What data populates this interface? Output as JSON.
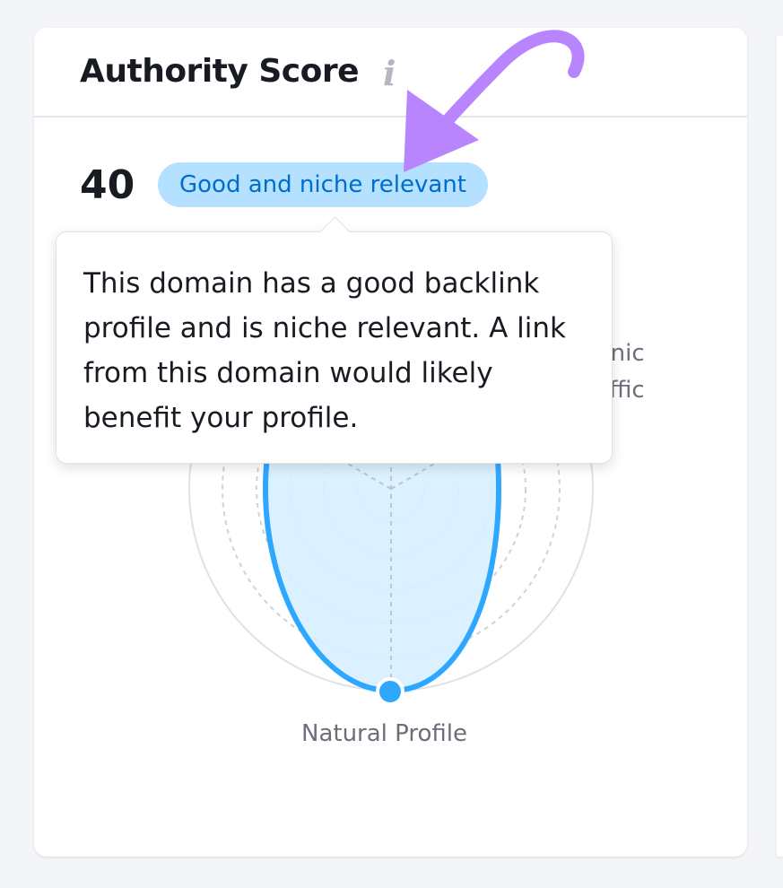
{
  "widget": {
    "title": "Authority Score",
    "info_icon": "info-icon"
  },
  "score": {
    "value": "40",
    "badge": "Good and niche relevant"
  },
  "tooltip": {
    "text": "This domain has a good backlink profile and is niche relevant. A link from this domain would likely benefit your profile."
  },
  "radar": {
    "axis_labels": {
      "bottom": "Natural Profile",
      "right_line1": "rganic",
      "right_line2": "raffic"
    }
  },
  "colors": {
    "accent": "#2ea8ff",
    "fill": "#d8f0ff",
    "badge_bg": "#b3e1ff",
    "badge_text": "#006dca",
    "arrow": "#b985ff"
  }
}
